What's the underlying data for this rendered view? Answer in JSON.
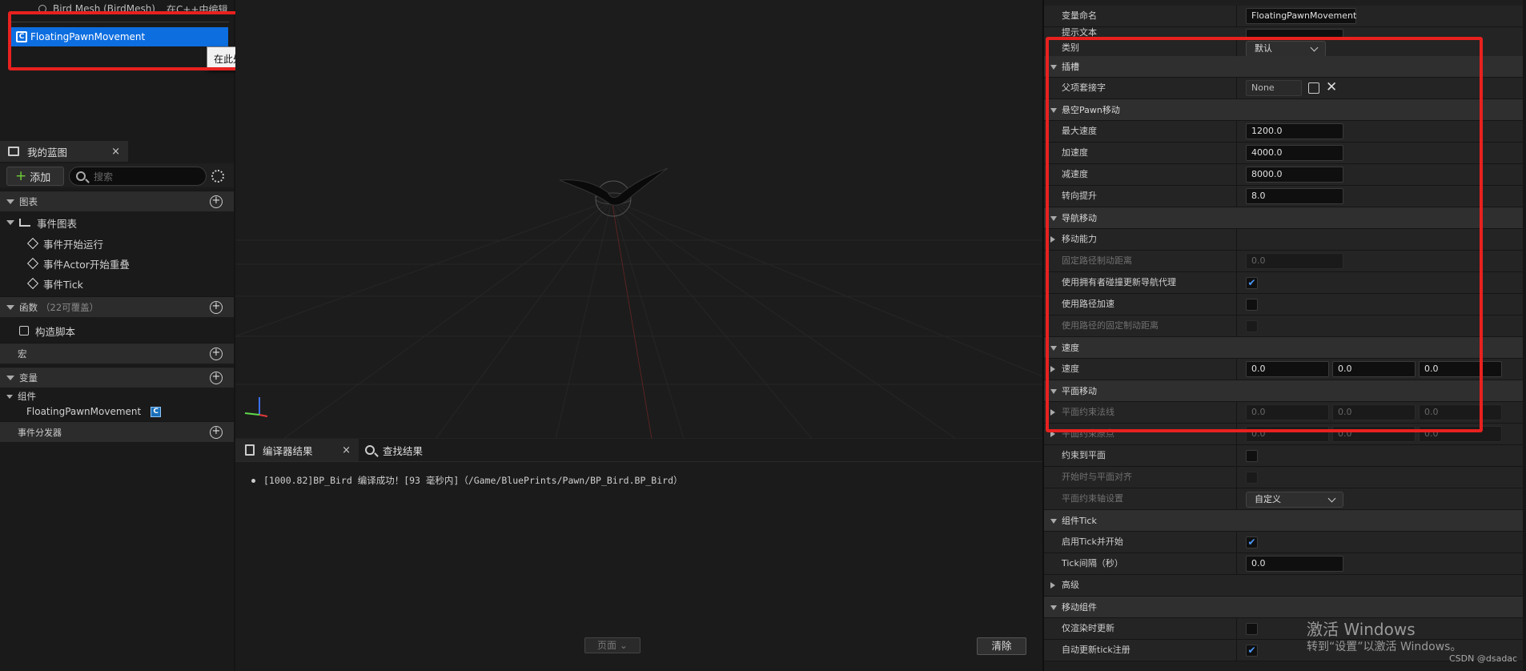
{
  "component_tree": {
    "mesh_row": "Bird Mesh (BirdMesh)",
    "mesh_edit": "在C++中编辑",
    "selected": "FloatingPawnMovement",
    "selected_icon": "class-component-icon",
    "tooltip": "在此处放置资产添加组件。"
  },
  "my_blueprint": {
    "tab_label": "我的蓝图",
    "add_label": "添加",
    "search_placeholder": "搜索",
    "sections": {
      "graphs": "图表",
      "functions": "函数",
      "functions_sub": "（22可覆盖）",
      "macros": "宏",
      "variables": "变量",
      "dispatchers": "事件分发器"
    },
    "event_graph": "事件图表",
    "events": [
      "事件开始运行",
      "事件Actor开始重叠",
      "事件Tick"
    ],
    "construction": "构造脚本",
    "components_group": "组件",
    "component_var": "FloatingPawnMovement"
  },
  "bottom": {
    "tab_compiler": "编译器结果",
    "tab_find": "查找结果",
    "log": "[1000.82]BP_Bird 编译成功！[93 毫秒内]（/Game/BluePrints/Pawn/BP_Bird.BP_Bird）",
    "page_label": "页面",
    "clear_label": "清除"
  },
  "details": {
    "var_name_label": "变量命名",
    "var_name_value": "FloatingPawnMovement",
    "tooltip_label": "提示文本",
    "category_label": "类别",
    "category_value": "默认",
    "socket_cat": "插槽",
    "parent_socket_label": "父项套接字",
    "parent_socket_value": "None",
    "fpm_cat": "悬空Pawn移动",
    "max_speed_label": "最大速度",
    "max_speed": "1200.0",
    "accel_label": "加速度",
    "accel": "4000.0",
    "decel_label": "减速度",
    "decel": "8000.0",
    "turn_boost_label": "转向提升",
    "turn_boost": "8.0",
    "nav_cat": "导航移动",
    "move_caps_label": "移动能力",
    "fixed_path_label": "固定路径制动距离",
    "fixed_path_value": "0.0",
    "use_owner_collision_label": "使用拥有者碰撞更新导航代理",
    "use_owner_collision": true,
    "use_accel_path_label": "使用路径加速",
    "use_accel_path": false,
    "use_fixed_brake_label": "使用路径的固定制动距离",
    "velocity_cat": "速度",
    "velocity_label": "速度",
    "velocity": [
      "0.0",
      "0.0",
      "0.0"
    ],
    "planar_cat": "平面移动",
    "planar_normal_label": "平面约束法线",
    "planar_normal": [
      "0.0",
      "0.0",
      "0.0"
    ],
    "planar_origin_label": "平面约束原点",
    "planar_origin": [
      "0.0",
      "0.0",
      "0.0"
    ],
    "constrain_label": "约束到平面",
    "snap_label": "开始时与平面对齐",
    "axis_setting_label": "平面约束轴设置",
    "axis_setting_value": "自定义",
    "tick_cat": "组件Tick",
    "start_tick_label": "启用Tick并开始",
    "start_tick": true,
    "tick_interval_label": "Tick间隔（秒）",
    "tick_interval": "0.0",
    "advanced_label": "高级",
    "move_comp_cat": "移动组件",
    "update_render_label": "仅渲染时更新",
    "auto_register_label": "自动更新tick注册"
  },
  "watermark": {
    "line1": "激活 Windows",
    "line2": "转到“设置”以激活 Windows。",
    "csdn": "CSDN @dsadac"
  },
  "colors": {
    "accent": "#0d6ee0",
    "highlight_box": "#e8211f",
    "add_plus": "#6fcf3a"
  }
}
